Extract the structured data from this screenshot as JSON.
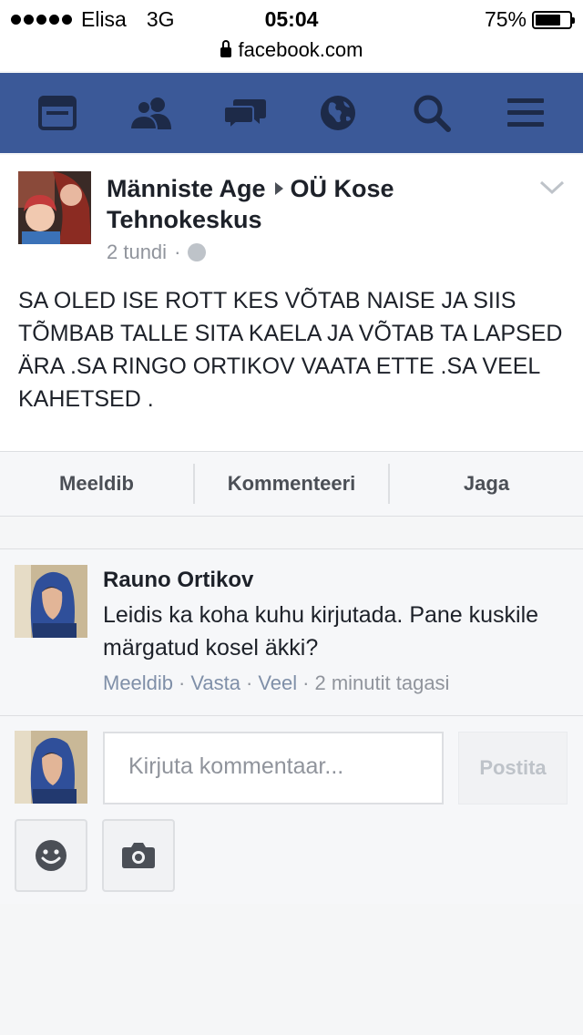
{
  "status_bar": {
    "carrier": "Elisa",
    "network": "3G",
    "time": "05:04",
    "battery": "75%",
    "battery_level": 0.75,
    "url": "facebook.com"
  },
  "nav": {
    "items": [
      "news-feed-icon",
      "friends-icon",
      "messages-icon",
      "notifications-globe-icon",
      "search-icon",
      "menu-icon"
    ],
    "color": "#3b5998"
  },
  "post": {
    "author": "Männiste Age",
    "target": "OÜ Kose Tehnokeskus",
    "time": "2 tundi",
    "time_separator": "·",
    "text": "SA OLED ISE ROTT KES VÕTAB NAISE JA SIIS TÕMBAB TALLE SITA KAELA JA VÕTAB TA LAPSED ÄRA .SA RINGO ORTIKOV VAATA ETTE .SA VEEL KAHETSED ."
  },
  "actions": {
    "like": "Meeldib",
    "comment": "Kommenteeri",
    "share": "Jaga"
  },
  "comment": {
    "author": "Rauno Ortikov",
    "text": "Leidis ka koha kuhu kirjutada. Pane kuskile märgatud kosel äkki?",
    "like": "Meeldib",
    "reply": "Vasta",
    "more": "Veel",
    "time": "2 minutit tagasi",
    "separator": "·"
  },
  "composer": {
    "placeholder": "Kirjuta kommentaar...",
    "post_button": "Postita"
  }
}
